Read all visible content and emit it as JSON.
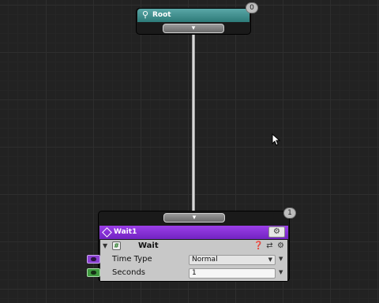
{
  "root_node": {
    "title": "Root",
    "badge": "0",
    "icon": "map-pin-icon"
  },
  "wait_node": {
    "title": "Wait1",
    "badge": "1",
    "component": {
      "title": "Wait",
      "icons": [
        "help-icon",
        "preset-icon",
        "settings-icon"
      ],
      "fields": [
        {
          "label": "Time Type",
          "type": "dropdown",
          "value": "Normal",
          "socket_color": "#8a3fd1"
        },
        {
          "label": "Seconds",
          "type": "number",
          "value": "1",
          "socket_color": "#3f9a3f"
        }
      ]
    }
  },
  "colors": {
    "root_header": "#4d9f9d",
    "wait_header": "#8a34dc",
    "canvas": "#222222"
  }
}
